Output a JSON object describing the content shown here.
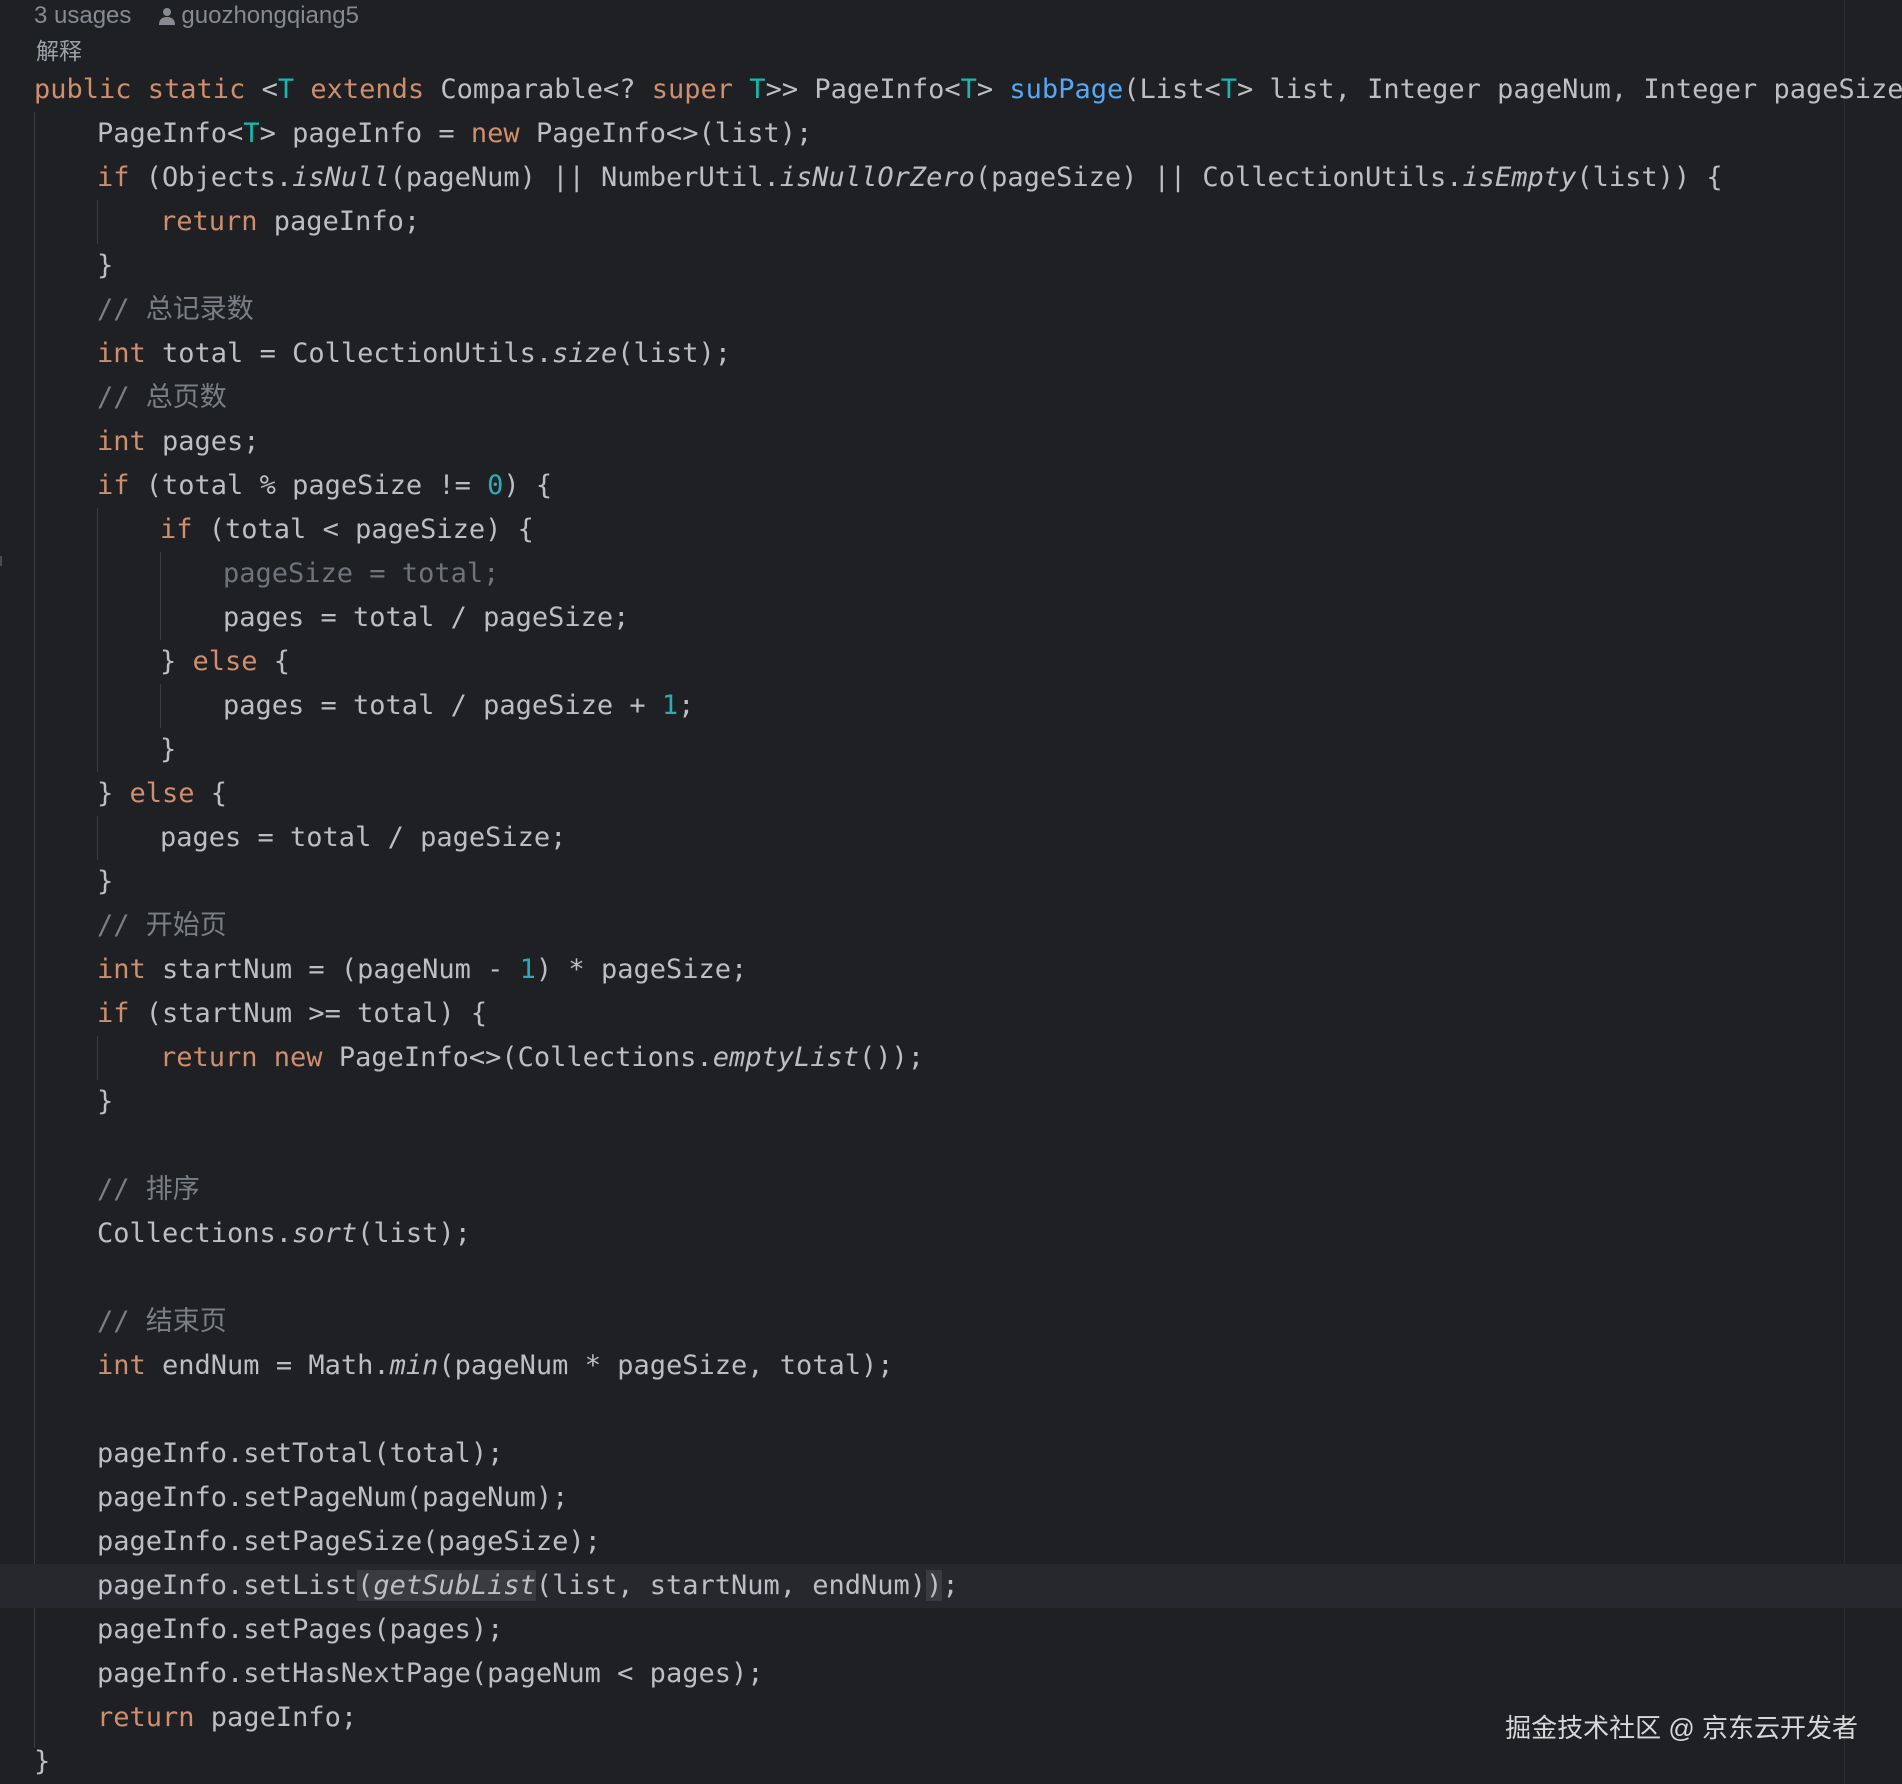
{
  "inlay_hints": {
    "usages": "3 usages",
    "author": "guozhongqiang5",
    "author_icon": "person-icon"
  },
  "explain_link": "解释",
  "code": {
    "l0": {
      "a": "public static ",
      "b": "<",
      "c": "T",
      "d": " extends ",
      "e": "Comparable<? ",
      "f": "super ",
      "g": "T",
      "h": ">> PageInfo<",
      "i": "T",
      "j": "> ",
      "k": "subPage",
      "l": "(List<",
      "m": "T",
      "n": "> list, Integer pageNum, Integer pageSize) {"
    },
    "l1": {
      "a": "PageInfo<",
      "b": "T",
      "c": "> pageInfo = ",
      "d": "new ",
      "e": "PageInfo<>(list);"
    },
    "l2": {
      "a": "if ",
      "b": "(Objects.",
      "c": "isNull",
      "d": "(pageNum) || NumberUtil.",
      "e": "isNullOrZero",
      "f": "(pageSize) || CollectionUtils.",
      "g": "isEmpty",
      "h": "(list)) {"
    },
    "l3": {
      "a": "return ",
      "b": "pageInfo;"
    },
    "l4": "}",
    "l5": "// 总记录数",
    "l6": {
      "a": "int ",
      "b": "total = CollectionUtils.",
      "c": "size",
      "d": "(list);"
    },
    "l7": "// 总页数",
    "l8": {
      "a": "int ",
      "b": "pages;"
    },
    "l9": {
      "a": "if ",
      "b": "(total % pageSize != ",
      "c": "0",
      "d": ") {"
    },
    "l10": {
      "a": "if ",
      "b": "(total < pageSize) {"
    },
    "l11": "pageSize = total;",
    "l12": "pages = total / pageSize;",
    "l13": {
      "a": "} ",
      "b": "else ",
      "c": "{"
    },
    "l14": {
      "a": "pages = total / pageSize + ",
      "b": "1",
      "c": ";"
    },
    "l15": "}",
    "l16": {
      "a": "} ",
      "b": "else ",
      "c": "{"
    },
    "l17": "pages = total / pageSize;",
    "l18": "}",
    "l19": "// 开始页",
    "l20": {
      "a": "int ",
      "b": "startNum = (pageNum - ",
      "c": "1",
      "d": ") * pageSize;"
    },
    "l21": {
      "a": "if ",
      "b": "(startNum >= total) {"
    },
    "l22": {
      "a": "return new ",
      "b": "PageInfo<>(Collections.",
      "c": "emptyList",
      "d": "());"
    },
    "l23": "}",
    "l25": "// 排序",
    "l26": {
      "a": "Collections.",
      "b": "sort",
      "c": "(list);"
    },
    "l28": "// 结束页",
    "l29": {
      "a": "int ",
      "b": "endNum = Math.",
      "c": "min",
      "d": "(pageNum * pageSize, total);"
    },
    "l31": "pageInfo.setTotal(total);",
    "l32": "pageInfo.setPageNum(pageNum);",
    "l33": "pageInfo.setPageSize(pageSize);",
    "l34": {
      "a": "pageInfo.setList",
      "b": "(",
      "c": "getSubList",
      "d": "(list, startNum, endNum)",
      "e": ")",
      "f": ";"
    },
    "l35": "pageInfo.setPages(pages);",
    "l36": "pageInfo.setHasNextPage(pageNum < pages);",
    "l37": {
      "a": "return ",
      "b": "pageInfo;"
    },
    "l38": "}"
  },
  "watermark": "掘金技术社区 @ 京东云开发者",
  "colors": {
    "background": "#1f2023",
    "keyword": "#cf8e6d",
    "type_param": "#16baac",
    "method_decl": "#56a8f5",
    "number": "#2aacb8",
    "comment": "#7a7e85",
    "text": "#bcbec4"
  }
}
